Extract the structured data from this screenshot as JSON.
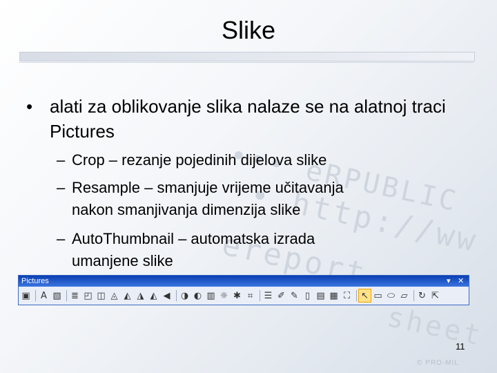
{
  "slide": {
    "title": "Slike",
    "bullet": "alati za oblikovanje slika nalaze se na alatnoj traci Pictures",
    "bullet_symbol": "•",
    "sub_items": [
      {
        "dash": "–",
        "line1": "Crop – rezanje pojedinih dijelova slike",
        "line2": ""
      },
      {
        "dash": "–",
        "line1": "Resample – smanjuje vrijeme učitavanja",
        "line2": "nakon smanjivanja dimenzija slike"
      },
      {
        "dash": "–",
        "line1": "AutoThumbnail – automatska izrada",
        "line2": "umanjene slike"
      }
    ],
    "page_number": "11",
    "footer": "© PRO-MIL"
  },
  "toolbar": {
    "title": "Pictures",
    "options_glyph": "▾",
    "close_glyph": "✕",
    "buttons": [
      {
        "name": "insert-picture-icon",
        "glyph": "▣"
      },
      {
        "name": "insert-wordart-icon",
        "glyph": "A"
      },
      {
        "name": "picture-icon",
        "glyph": "▧"
      },
      {
        "name": "align-icon",
        "glyph": "≣"
      },
      {
        "name": "arrange-icon",
        "glyph": "◰"
      },
      {
        "name": "group-icon",
        "glyph": "◫"
      },
      {
        "name": "shape-icon",
        "glyph": "◬"
      },
      {
        "name": "rotate-left-icon",
        "glyph": "◭"
      },
      {
        "name": "rotate-right-icon",
        "glyph": "◮"
      },
      {
        "name": "flip-icon",
        "glyph": "◭"
      },
      {
        "name": "reflect-icon",
        "glyph": "◀"
      },
      {
        "name": "contrast-icon",
        "glyph": "◑"
      },
      {
        "name": "brightness-icon",
        "glyph": "◐"
      },
      {
        "name": "color-icon",
        "glyph": "▥"
      },
      {
        "name": "sun-icon",
        "glyph": "☼"
      },
      {
        "name": "effects-icon",
        "glyph": "✱"
      },
      {
        "name": "crop-icon",
        "glyph": "⌗"
      },
      {
        "name": "line-style-icon",
        "glyph": "☰"
      },
      {
        "name": "brush-icon",
        "glyph": "✐"
      },
      {
        "name": "pen-icon",
        "glyph": "✎"
      },
      {
        "name": "compress-icon",
        "glyph": "▯"
      },
      {
        "name": "resample-icon",
        "glyph": "▤"
      },
      {
        "name": "thumbnail-icon",
        "glyph": "▦"
      },
      {
        "name": "transform-icon",
        "glyph": "⛶"
      },
      {
        "name": "select-icon",
        "glyph": "↖",
        "active": true
      },
      {
        "name": "rectangle-icon",
        "glyph": "▭"
      },
      {
        "name": "ellipse-icon",
        "glyph": "⬭"
      },
      {
        "name": "polygon-icon",
        "glyph": "▱"
      },
      {
        "name": "rotate-icon",
        "glyph": "↻"
      },
      {
        "name": "reset-icon",
        "glyph": "⇱"
      }
    ]
  }
}
